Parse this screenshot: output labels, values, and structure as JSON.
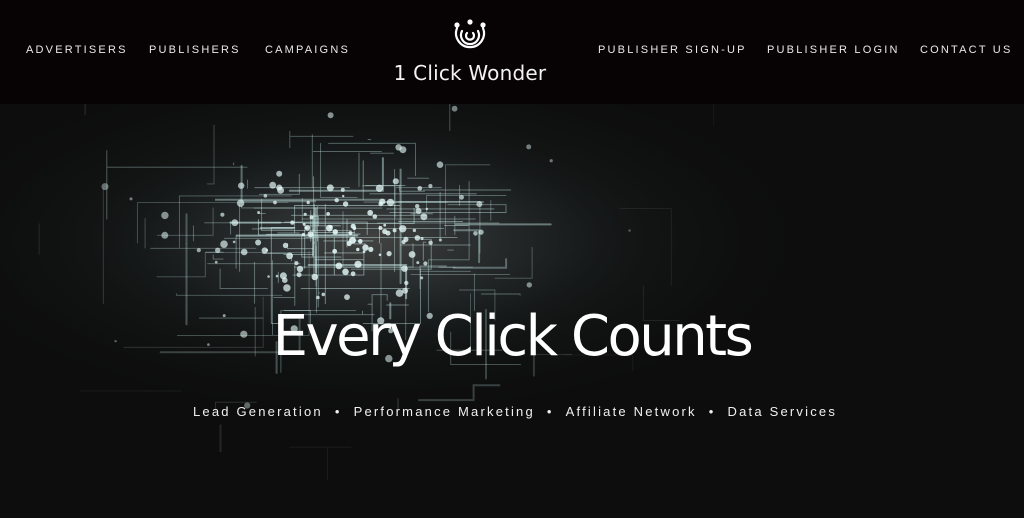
{
  "nav": {
    "left": [
      {
        "label": "ADVERTISERS"
      },
      {
        "label": "PUBLISHERS"
      },
      {
        "label": "CAMPAIGNS"
      }
    ],
    "right": [
      {
        "label": "PUBLISHER SIGN-UP"
      },
      {
        "label": "PUBLISHER LOGIN"
      },
      {
        "label": "CONTACT US"
      }
    ]
  },
  "brand": {
    "name": "1 Click Wonder",
    "icon": "logo-icon"
  },
  "hero": {
    "headline": "Every Click Counts",
    "services": [
      "Lead Generation",
      "Performance Marketing",
      "Affiliate Network",
      "Data Services"
    ],
    "separator": "•",
    "background": "network-lines-graphic"
  },
  "colors": {
    "header_bg": "#070304",
    "hero_bg": "#0d0d0d",
    "text": "#ffffff",
    "network_accent": "#bfe8e6"
  }
}
